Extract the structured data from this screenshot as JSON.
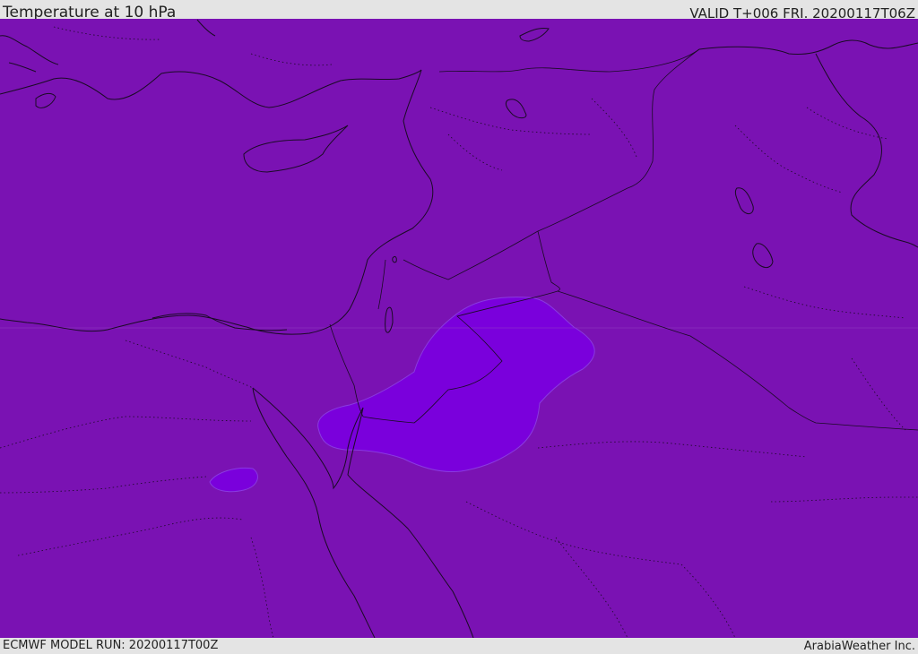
{
  "header": {
    "title": "Temperature at 10 hPa",
    "valid": "VALID T+006 FRI. 20200117T06Z"
  },
  "footer": {
    "model_run": "ECMWF MODEL RUN: 20200117T00Z",
    "credit": "ArabiaWeather Inc."
  },
  "map": {
    "region": "Eastern Mediterranean / Middle East",
    "fill_color": "#7a12b3",
    "highlight_color": "#7a00dc",
    "coastline_color": "#1a0b24"
  }
}
